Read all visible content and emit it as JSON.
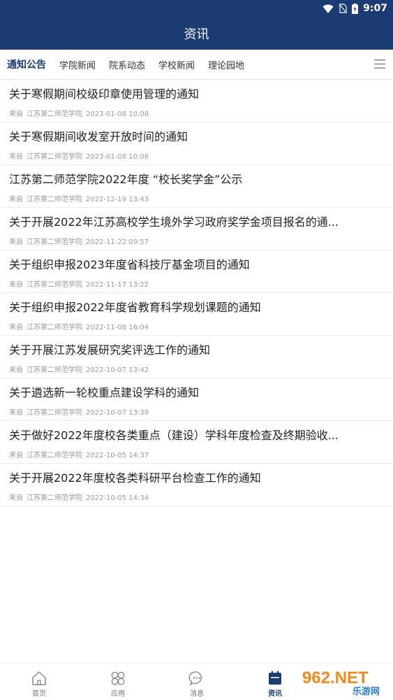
{
  "status_bar": {
    "time": "9:07"
  },
  "header": {
    "title": "资讯"
  },
  "tabs": [
    {
      "label": "通知公告",
      "active": true
    },
    {
      "label": "学院新闻"
    },
    {
      "label": "院系动态"
    },
    {
      "label": "学校新闻"
    },
    {
      "label": "理论园地"
    }
  ],
  "news": [
    {
      "title": "关于寒假期间校级印章使用管理的通知",
      "prefix": "来自",
      "source": "江苏第二师范学院",
      "time": "2023-01-08 10:08"
    },
    {
      "title": "关于寒假期间收发室开放时间的通知",
      "prefix": "来自",
      "source": "江苏第二师范学院",
      "time": "2023-01-08 10:06"
    },
    {
      "title": "江苏第二师范学院2022年度 “校长奖学金”公示",
      "prefix": "来自",
      "source": "江苏第二师范学院",
      "time": "2022-12-19 13:43"
    },
    {
      "title": "关于开展2022年江苏高校学生境外学习政府奖学金项目报名的通...",
      "prefix": "来自",
      "source": "江苏第二师范学院",
      "time": "2022-11-22 09:57"
    },
    {
      "title": "关于组织申报2023年度省科技厅基金项目的通知",
      "prefix": "来自",
      "source": "江苏第二师范学院",
      "time": "2022-11-17 13:22"
    },
    {
      "title": "关于组织申报2022年度省教育科学规划课题的通知",
      "prefix": "来自",
      "source": "江苏第二师范学院",
      "time": "2022-11-08 16:04"
    },
    {
      "title": "关于开展江苏发展研究奖评选工作的通知",
      "prefix": "来自",
      "source": "江苏第二师范学院",
      "time": "2022-10-07 13:42"
    },
    {
      "title": "关于遴选新一轮校重点建设学科的通知",
      "prefix": "来自",
      "source": "江苏第二师范学院",
      "time": "2022-10-07 13:39"
    },
    {
      "title": "关于做好2022年度校各类重点（建设）学科年度检查及终期验收...",
      "prefix": "来自",
      "source": "江苏第二师范学院",
      "time": "2022-10-05 14:37"
    },
    {
      "title": "关于开展2022年度校各类科研平台检查工作的通知",
      "prefix": "来自",
      "source": "江苏第二师范学院",
      "time": "2022-10-05 14:34"
    }
  ],
  "bottom_nav": [
    {
      "label": "首页",
      "icon": "home-icon"
    },
    {
      "label": "应用",
      "icon": "apps-icon"
    },
    {
      "label": "消息",
      "icon": "message-icon"
    },
    {
      "label": "资讯",
      "icon": "news-icon",
      "active": true
    }
  ],
  "watermark": {
    "text_top": "962.NET",
    "text_bottom": "乐游网"
  },
  "colors": {
    "primary": "#1c3b72",
    "text": "#222222",
    "meta": "#999999"
  }
}
